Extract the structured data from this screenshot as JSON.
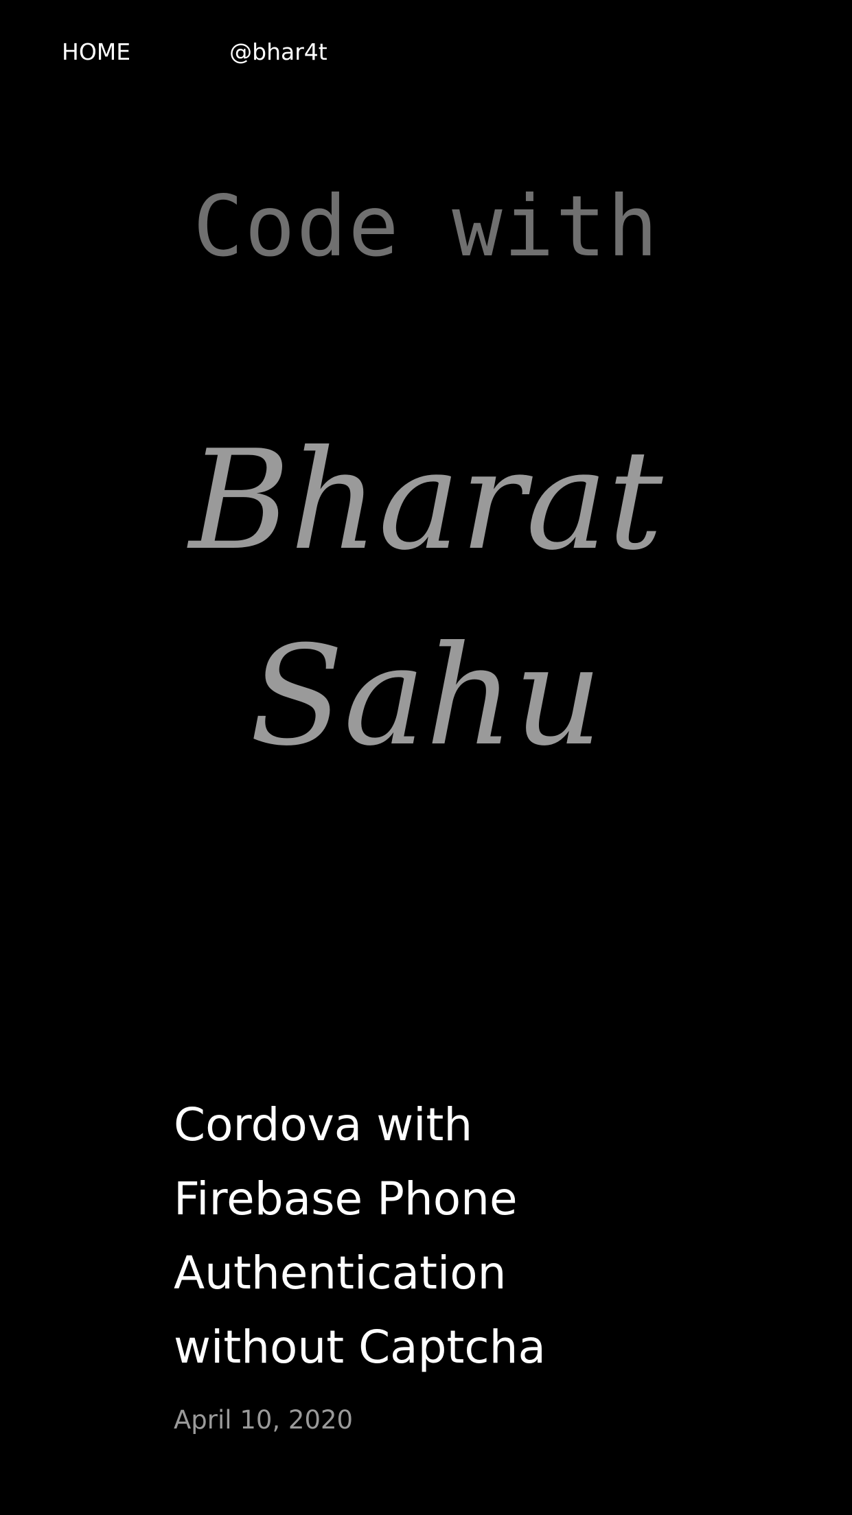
{
  "nav": {
    "home_label": "HOME",
    "handle_label": "@bhar4t"
  },
  "hero": {
    "code_with": "Code with",
    "first_name": "Bharat",
    "last_name": "Sahu"
  },
  "post": {
    "title_line1": "Cordova with",
    "title_line2": "Firebase Phone",
    "title_line3": "Authentication",
    "title_line4": "without Captcha",
    "date": "April 10, 2020"
  },
  "colors": {
    "background": "#000000",
    "nav_text": "#ffffff",
    "hero_code": "#707070",
    "hero_script": "#9a9a9a",
    "post_title": "#ffffff",
    "post_date": "#9a9a9a"
  }
}
